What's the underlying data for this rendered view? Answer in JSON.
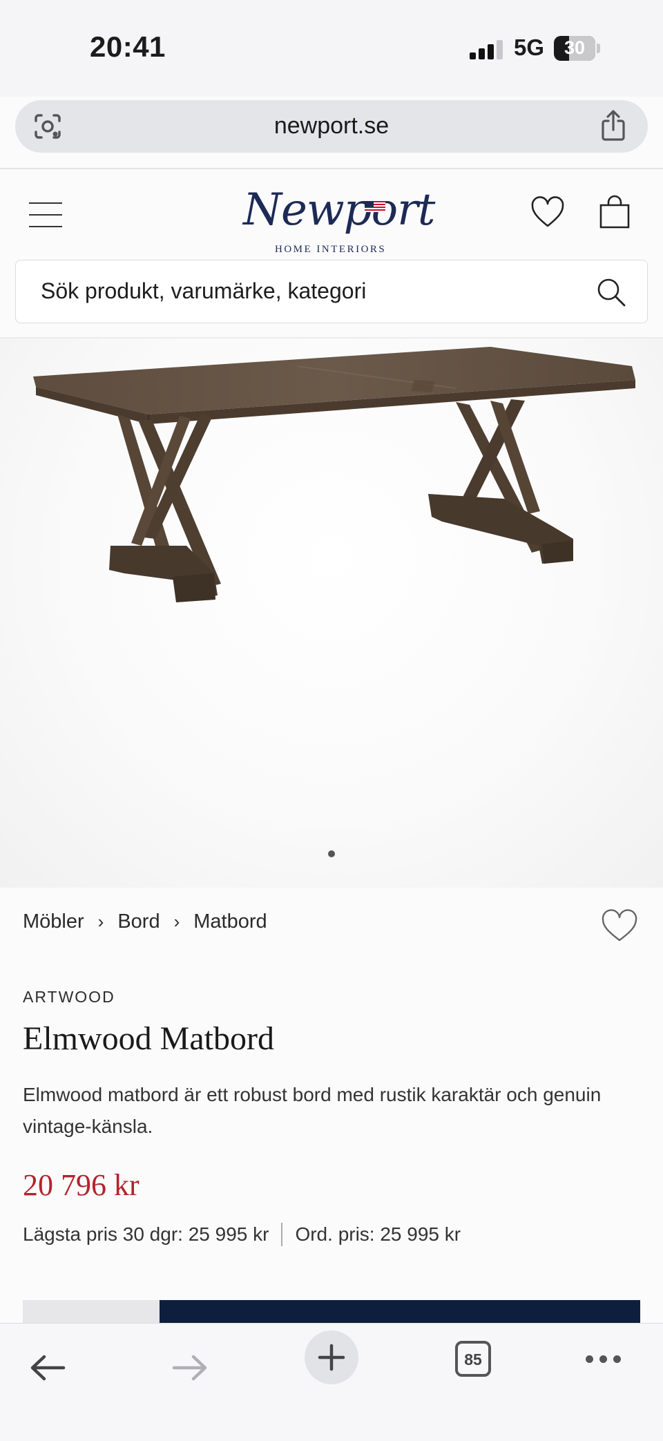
{
  "status_bar": {
    "time": "20:41",
    "network": "5G",
    "battery": "30"
  },
  "browser": {
    "url": "newport.se",
    "icons": [
      "lens-icon",
      "share-icon"
    ]
  },
  "header": {
    "logo_text": "Newport",
    "logo_subtitle": "HOME INTERIORS",
    "icons": [
      "menu-icon",
      "heart-icon",
      "bag-icon"
    ]
  },
  "search": {
    "placeholder": "Sök produkt, varumärke, kategori"
  },
  "gallery": {
    "current_slide": 1,
    "slide_count": 1
  },
  "breadcrumb": {
    "items": [
      "Möbler",
      "Bord",
      "Matbord"
    ],
    "separator": "›"
  },
  "product": {
    "brand": "ARTWOOD",
    "title": "Elmwood Matbord",
    "description": "Elmwood matbord är ett robust bord med rustik karaktär och genuin vintage-känsla.",
    "price": "20 796 kr",
    "lowest_price": "Lägsta pris 30 dgr: 25 995 kr",
    "ordinary_price": "Ord. pris: 25 995 kr"
  },
  "toolbar": {
    "tabs_count": "85",
    "icons": [
      "back-icon",
      "forward-icon",
      "plus-icon",
      "tabs-icon",
      "more-icon"
    ]
  },
  "colors": {
    "brand_navy": "#1d2a56",
    "sale_red": "#b4232b",
    "cta_navy": "#0d1f3c"
  }
}
